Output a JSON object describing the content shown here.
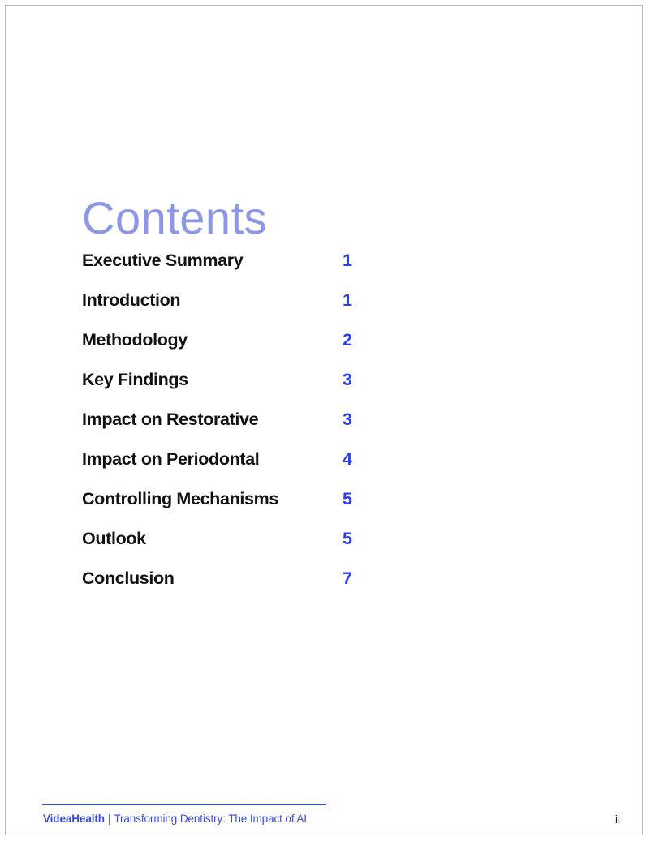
{
  "page": {
    "heading": "Contents",
    "number_label": "ii",
    "accent_color": "#2b3ee8",
    "heading_color": "#8d97e6",
    "rule_color": "#3344d8",
    "title_color": "#111111"
  },
  "toc": {
    "entries": [
      {
        "label": "Executive Summary",
        "page": "1"
      },
      {
        "label": "Introduction",
        "page": "1"
      },
      {
        "label": "Methodology",
        "page": "2"
      },
      {
        "label": "Key Findings",
        "page": "3"
      },
      {
        "label": "Impact on Restorative",
        "page": "3"
      },
      {
        "label": "Impact on Periodontal",
        "page": "4"
      },
      {
        "label": "Controlling Mechanisms",
        "page": "5"
      },
      {
        "label": "Outlook",
        "page": "5"
      },
      {
        "label": "Conclusion",
        "page": "7"
      }
    ]
  },
  "footer": {
    "brand": "VideaHealth",
    "separator": "|",
    "document_title": "Transforming Dentistry: The Impact of AI"
  }
}
